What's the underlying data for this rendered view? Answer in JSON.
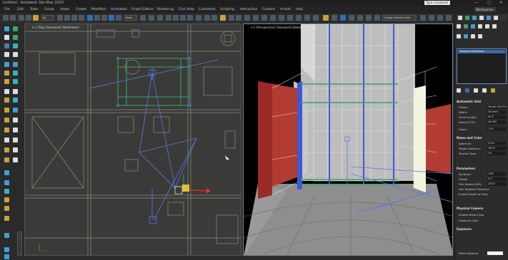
{
  "titlebar": {
    "title": "Untitled - Autodesk 3ds Max 2020",
    "search_label": "Type a keyword",
    "win_minimize": "—",
    "win_maximize": "□",
    "win_close": "✕"
  },
  "menu": {
    "items": [
      "File",
      "Edit",
      "Tools",
      "Group",
      "Views",
      "Create",
      "Modifiers",
      "Animation",
      "Graph Editors",
      "Rendering",
      "Civil View",
      "Customize",
      "Scripting",
      "Interactive",
      "Content",
      "Arnold",
      "Help"
    ],
    "workspace": "Workspaces"
  },
  "toolbar": {
    "selection_filter": "All",
    "view_dropdown": "View",
    "selection_set": "Create Selection Set"
  },
  "viewports": {
    "left_label": "[+] [Top] [Standard] [Wireframe]",
    "right_label": "[+] [Perspective] [Standard] [Default Shading]"
  },
  "panel": {
    "object_header": "Object Type",
    "list_item": "Standard Primitives",
    "rollouts": [
      {
        "label": "Automatic Grid"
      },
      {
        "label": "Name and Color"
      },
      {
        "label": "Parameters"
      },
      {
        "label": "Physical Camera"
      },
      {
        "label": "Exposure"
      }
    ],
    "params": [
      {
        "label": "Preset:",
        "value": "35mm (Full Frame)"
      },
      {
        "label": "Width:",
        "value": "36.0mm"
      },
      {
        "label": "Focal Length:",
        "value": "40.0"
      },
      {
        "label": "Specify FOV:",
        "value": "48.455"
      },
      {
        "label": "Zoom:",
        "value": "1.0x"
      },
      {
        "label": "Aperture:",
        "value": "f/ 8.0"
      },
      {
        "label": "Target Distance:",
        "value": "160.0"
      },
      {
        "label": "Shutter Type:",
        "value": "1/s"
      },
      {
        "label": "Duration:",
        "value": "1/30"
      },
      {
        "label": "Offset:",
        "value": "0.0"
      },
      {
        "label": "Film Speed (ISO):",
        "value": "100.0"
      },
      {
        "label": "Use Targeted Distance"
      },
      {
        "label": "Enable Depth of Field"
      },
      {
        "label": "Enable Motion Blur"
      },
      {
        "label": "Exposure Gain"
      },
      {
        "label": "White Balance"
      }
    ]
  },
  "colors": {
    "accent": "#2f6fb5",
    "wire_green": "#3aa56b",
    "wire_blue": "#4a6fe0",
    "wall_red": "#b23b32",
    "gizmo_yellow": "#d8c23a"
  }
}
